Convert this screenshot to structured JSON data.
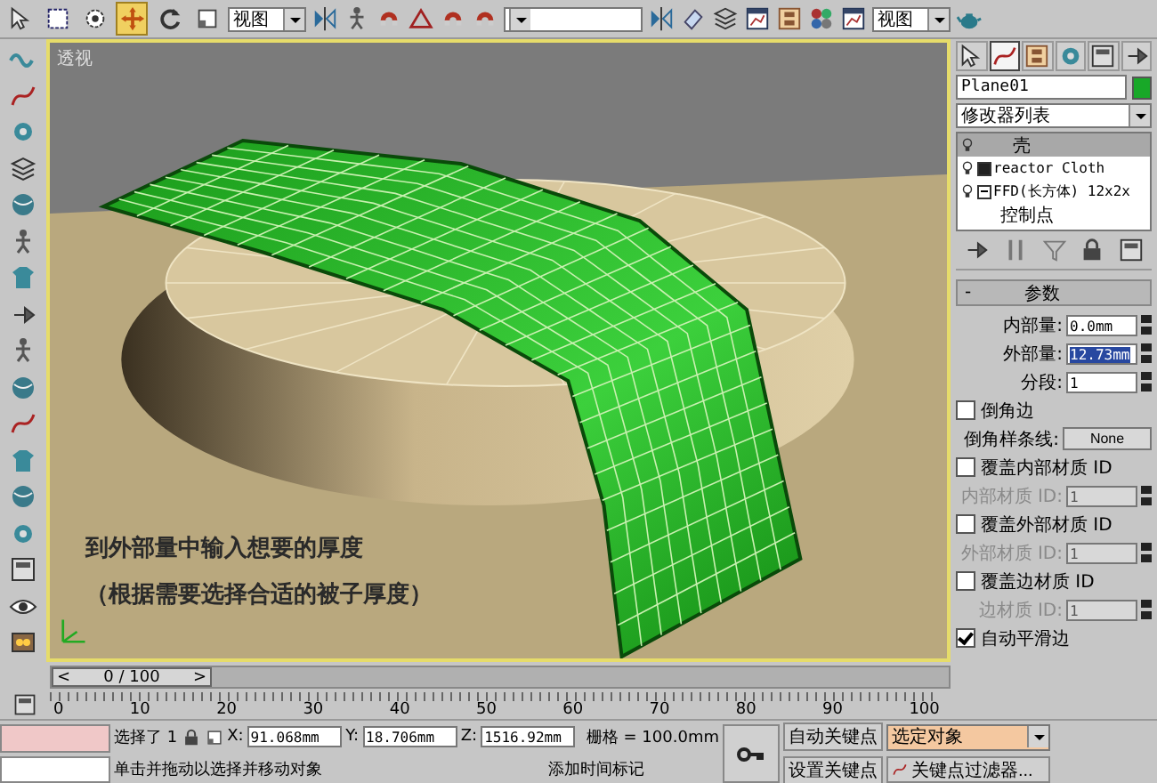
{
  "toolbar": {
    "tools": [
      {
        "selected": false
      },
      {
        "selected": false
      },
      {
        "selected": false
      },
      {
        "selected": true
      },
      {
        "selected": false
      },
      {
        "selected": false
      }
    ],
    "coord_dropdown": "视图",
    "render_dropdown": "视图"
  },
  "viewport": {
    "label": "透视",
    "captions": [
      "到外部量中输入想要的厚度",
      "（根据需要选择合适的被子厚度）"
    ]
  },
  "command_panel": {
    "tabs": [
      {
        "selected": false
      },
      {
        "selected": true
      },
      {
        "selected": false
      },
      {
        "selected": false
      },
      {
        "selected": false
      },
      {
        "selected": false
      }
    ],
    "object_name": "Plane01",
    "modifier_list": "修改器列表",
    "stack": [
      {
        "label": "壳",
        "selected": true
      },
      {
        "label": "reactor Cloth",
        "selected": false
      },
      {
        "label": "FFD(长方体) 12x2x",
        "selected": false,
        "children": [
          {
            "label": "控制点",
            "selected": false
          }
        ]
      }
    ],
    "rollout": {
      "title": "参数",
      "collapse": "-"
    },
    "params": [
      {
        "kind": "spinner",
        "label": "内部量:",
        "value": "0.0mm",
        "selected": false,
        "disabled": false
      },
      {
        "kind": "spinner",
        "label": "外部量:",
        "value": "12.73mm",
        "selected": true,
        "disabled": false
      },
      {
        "kind": "spinner",
        "label": "分段:",
        "value": "1",
        "selected": false,
        "disabled": false
      },
      {
        "kind": "checkbox",
        "label": "倒角边",
        "checked": false
      },
      {
        "kind": "button",
        "label": "倒角样条线:",
        "value": "None"
      },
      {
        "kind": "checkbox",
        "label": "覆盖内部材质 ID",
        "checked": false
      },
      {
        "kind": "spinner",
        "label": "内部材质 ID:",
        "value": "1",
        "selected": false,
        "disabled": true
      },
      {
        "kind": "checkbox",
        "label": "覆盖外部材质 ID",
        "checked": false
      },
      {
        "kind": "spinner",
        "label": "外部材质 ID:",
        "value": "1",
        "selected": false,
        "disabled": true
      },
      {
        "kind": "checkbox",
        "label": "覆盖边材质 ID",
        "checked": false
      },
      {
        "kind": "spinner",
        "label": "边材质 ID:",
        "value": "1",
        "selected": false,
        "disabled": true
      },
      {
        "kind": "checkbox",
        "label": "自动平滑边",
        "checked": true
      }
    ]
  },
  "time_slider": {
    "prev": "<",
    "label": "0 / 100",
    "next": ">",
    "level": 0
  },
  "ruler": {
    "labels": [
      "0",
      "10",
      "20",
      "30",
      "40",
      "50",
      "60",
      "70",
      "80",
      "90",
      "100"
    ]
  },
  "status_bar": {
    "selection": "选择了 1",
    "x_label": "X:",
    "x": "91.068mm",
    "y_label": "Y:",
    "y": "18.706mm",
    "z_label": "Z:",
    "z": "1516.92mm",
    "grid": "栅格 = 100.0mm",
    "prompt": "单击并拖动以选择并移动对象",
    "add_time_tag": "添加时间标记",
    "auto_key": "自动关键点",
    "set_key": "设置关键点",
    "key_mode": "选定对象",
    "key_filters": "关键点过滤器..."
  }
}
